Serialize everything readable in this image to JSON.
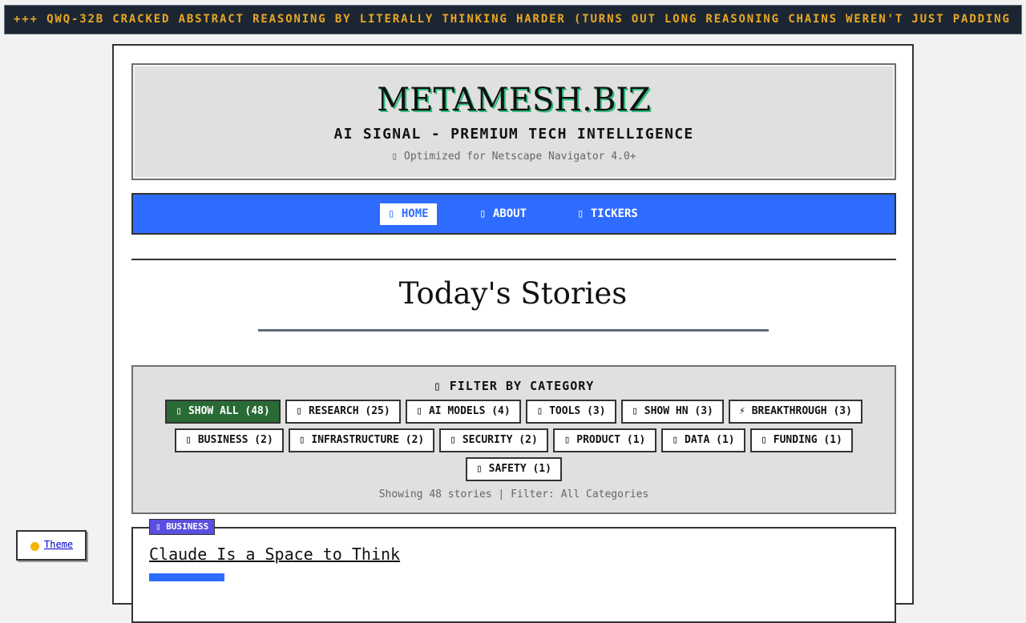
{
  "ticker": {
    "text": "+++ QWQ-32B CRACKED ABSTRACT REASONING BY LITERALLY THINKING HARDER (TURNS OUT LONG REASONING CHAINS WEREN'T JUST PADDING"
  },
  "header": {
    "title": "METAMESH.BIZ",
    "subtitle": "AI SIGNAL - PREMIUM TECH INTELLIGENCE",
    "note": "▯ Optimized for Netscape Navigator 4.0+"
  },
  "nav": {
    "items": [
      {
        "label": "▯ HOME",
        "active": true
      },
      {
        "label": "▯ ABOUT",
        "active": false
      },
      {
        "label": "▯ TICKERS",
        "active": false
      }
    ]
  },
  "main": {
    "section_title": "Today's Stories"
  },
  "filter": {
    "heading": "▯ FILTER BY CATEGORY",
    "chips": [
      {
        "label": "▯ SHOW ALL (48)",
        "active": true
      },
      {
        "label": "▯ RESEARCH (25)",
        "active": false
      },
      {
        "label": "▯ AI MODELS (4)",
        "active": false
      },
      {
        "label": "▯ TOOLS (3)",
        "active": false
      },
      {
        "label": "▯ SHOW HN (3)",
        "active": false
      },
      {
        "label": "⚡ BREAKTHROUGH (3)",
        "active": false
      },
      {
        "label": "▯ BUSINESS (2)",
        "active": false
      },
      {
        "label": "▯ INFRASTRUCTURE (2)",
        "active": false
      },
      {
        "label": "▯ SECURITY (2)",
        "active": false
      },
      {
        "label": "▯ PRODUCT (1)",
        "active": false
      },
      {
        "label": "▯ DATA (1)",
        "active": false
      },
      {
        "label": "▯ FUNDING (1)",
        "active": false
      },
      {
        "label": "▯ SAFETY (1)",
        "active": false
      }
    ],
    "status": "Showing 48 stories | Filter: All Categories"
  },
  "story": {
    "badge": "▯ BUSINESS",
    "title": "Claude Is a Space to Think"
  },
  "theme": {
    "label": "Theme",
    "dot_color": "#f5b400"
  },
  "colors": {
    "ticker_bg": "#1c2633",
    "ticker_text": "#e9a824",
    "nav_bg": "#2e6bff",
    "active_chip": "#2a6b35",
    "badge_business": "#5b4fe0",
    "title_shadow": "#2fbf7f"
  }
}
